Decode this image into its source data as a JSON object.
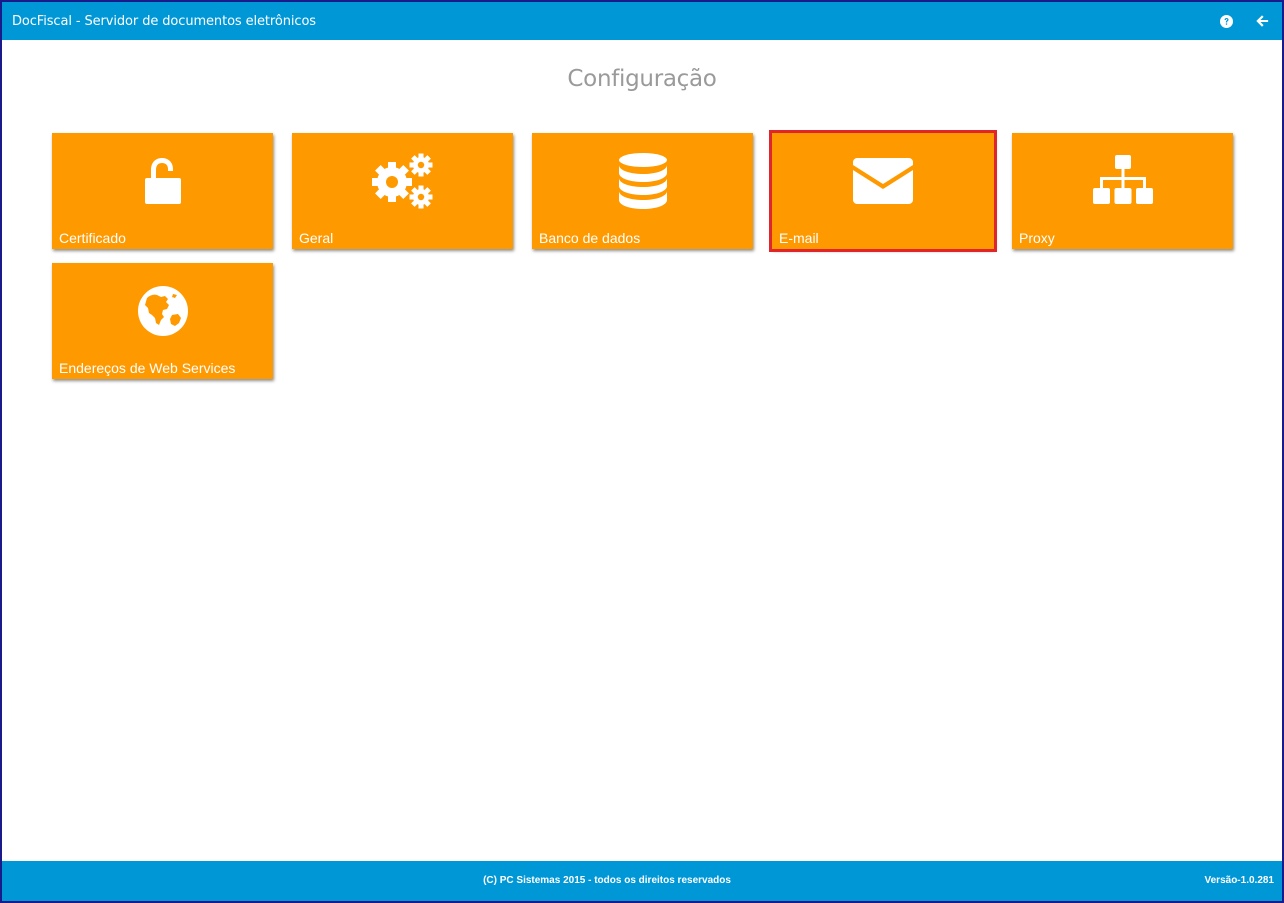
{
  "header": {
    "title": "DocFiscal - Servidor de documentos eletrônicos",
    "help_icon": "question-circle-icon",
    "back_icon": "arrow-left-icon"
  },
  "page": {
    "title": "Configuração"
  },
  "tiles": [
    {
      "label": "Certificado",
      "icon": "unlock-icon",
      "selected": false
    },
    {
      "label": "Geral",
      "icon": "gears-icon",
      "selected": false
    },
    {
      "label": "Banco de dados",
      "icon": "database-icon",
      "selected": false
    },
    {
      "label": "E-mail",
      "icon": "envelope-icon",
      "selected": true
    },
    {
      "label": "Proxy",
      "icon": "sitemap-icon",
      "selected": false
    },
    {
      "label": "Endereços de Web Services",
      "icon": "globe-icon",
      "selected": false
    }
  ],
  "footer": {
    "copyright": "(C) PC Sistemas 2015 - todos os direitos reservados",
    "version": "Versão-1.0.281"
  },
  "colors": {
    "header_bg": "#0097d7",
    "tile_bg": "#ff9900",
    "selected_border": "#e0262b",
    "title_text": "#9a9a9a"
  }
}
